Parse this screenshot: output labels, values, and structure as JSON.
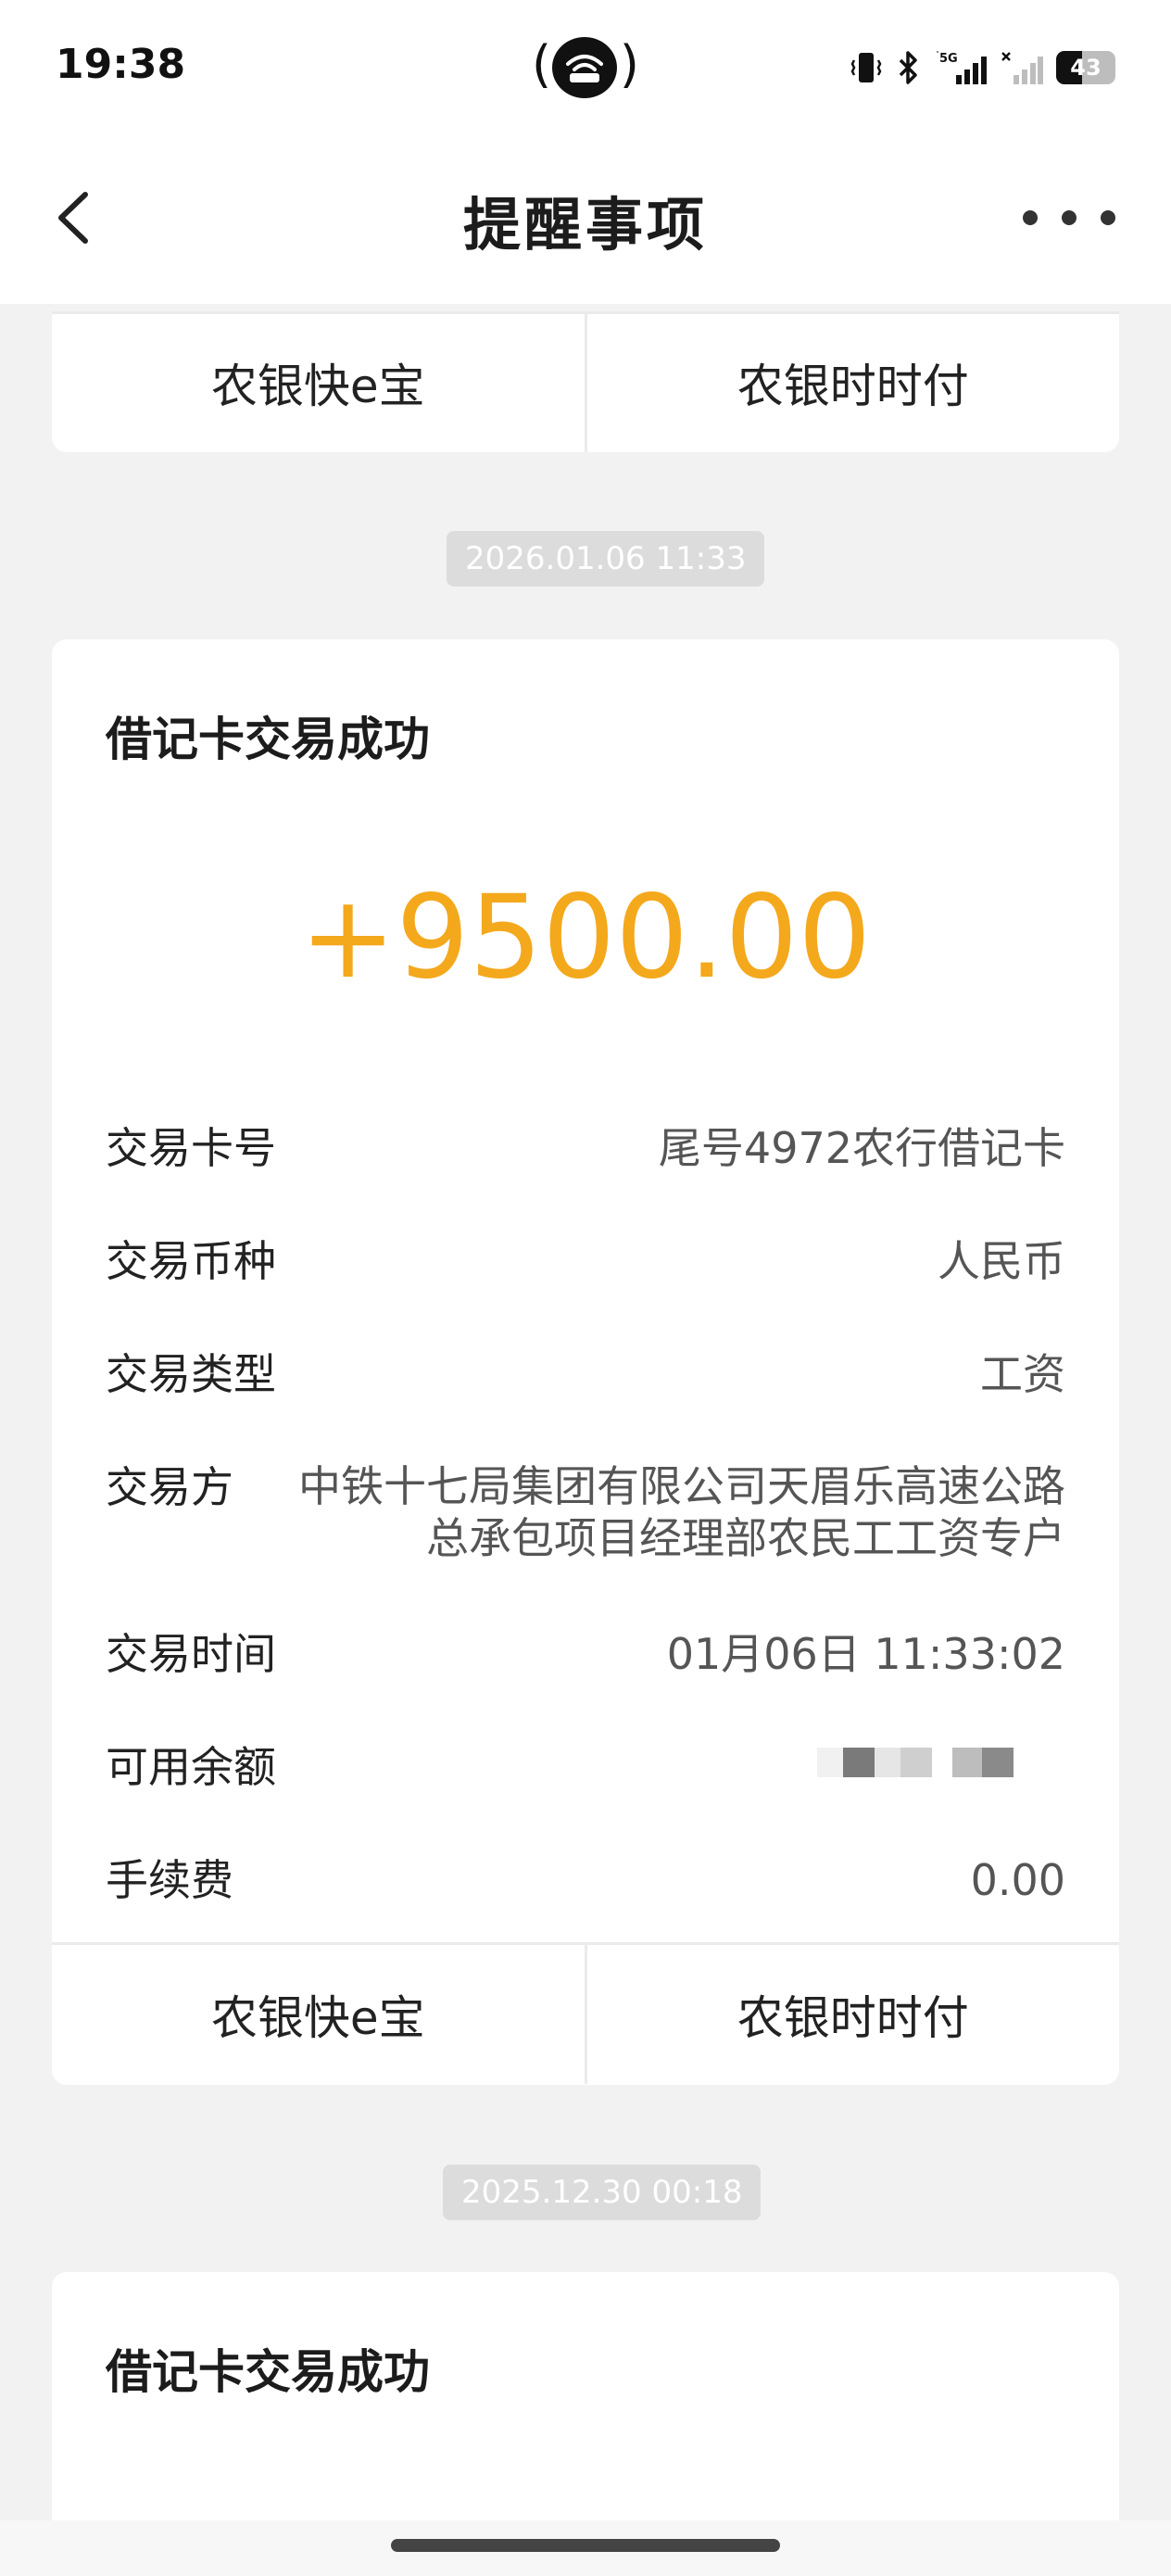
{
  "status_bar": {
    "time": "19:38",
    "network": "5G",
    "battery_level": "43",
    "battery_fraction": 0.43,
    "icons": [
      "vibrate-icon",
      "bluetooth-icon",
      "signal-5g-icon",
      "signal-no-service-icon",
      "battery-icon"
    ]
  },
  "nav": {
    "title": "提醒事项",
    "back_icon": "chevron-left-icon",
    "more_icon": "more-dots-icon"
  },
  "top_actions": {
    "left_label": "农银快e宝",
    "right_label": "农银时时付"
  },
  "message1": {
    "timestamp": "2026.01.06 11:33",
    "title": "借记卡交易成功",
    "amount": "+9500.00",
    "rows": [
      {
        "label": "交易卡号",
        "value": "尾号4972农行借记卡"
      },
      {
        "label": "交易币种",
        "value": "人民币"
      },
      {
        "label": "交易类型",
        "value": "工资"
      },
      {
        "label": "交易方",
        "value": "中铁十七局集团有限公司天眉乐高速公路总承包项目经理部农民工工资专户"
      },
      {
        "label": "交易时间",
        "value": "01月06日 11:33:02"
      },
      {
        "label": "可用余额",
        "value": ""
      },
      {
        "label": "手续费",
        "value": "0.00"
      }
    ],
    "actions": {
      "left_label": "农银快e宝",
      "right_label": "农银时时付"
    }
  },
  "message2": {
    "timestamp": "2025.12.30 00:18",
    "title": "借记卡交易成功"
  },
  "colors": {
    "amount": "#f4a81c",
    "background": "#f2f2f2",
    "chip": "#dcdcdc"
  }
}
